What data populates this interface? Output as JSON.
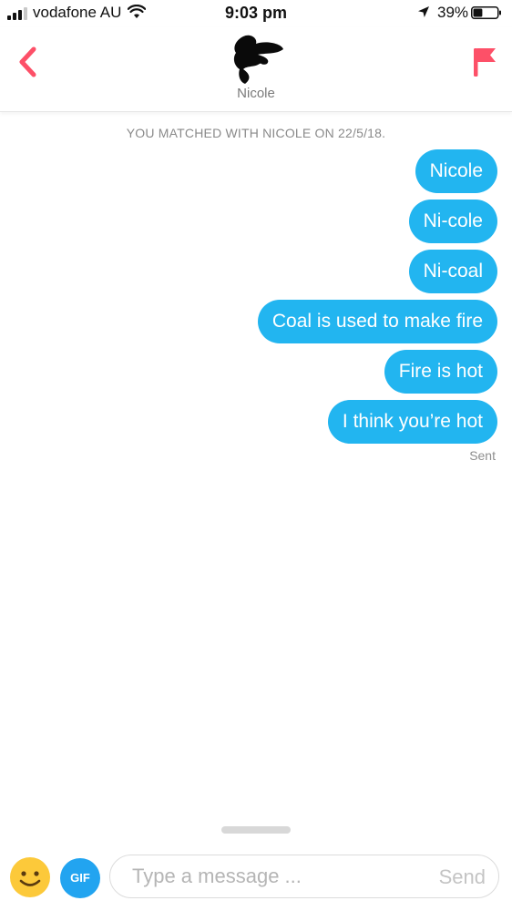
{
  "status_bar": {
    "carrier": "vodafone AU",
    "time": "9:03 pm",
    "battery_percent": "39%",
    "battery_level": 0.39,
    "icons": [
      "signal-icon",
      "wifi-icon",
      "location-arrow-icon",
      "battery-icon"
    ]
  },
  "header": {
    "match_name": "Nicole",
    "back_icon": "chevron-left-icon",
    "report_icon": "flag-icon",
    "accent_color": "#fd5068"
  },
  "conversation": {
    "match_notice": "YOU MATCHED WITH NICOLE ON 22/5/18.",
    "messages": [
      {
        "text": "Nicole",
        "sender": "me"
      },
      {
        "text": "Ni-cole",
        "sender": "me"
      },
      {
        "text": "Ni-coal",
        "sender": "me"
      },
      {
        "text": "Coal is used to make fire",
        "sender": "me"
      },
      {
        "text": "Fire is hot",
        "sender": "me"
      },
      {
        "text": "I think you’re hot",
        "sender": "me"
      }
    ],
    "status": "Sent",
    "bubble_color": "#22b5f0"
  },
  "composer": {
    "emoji_icon": "smiley-face-icon",
    "gif_label": "GIF",
    "placeholder": "Type a message ...",
    "value": "",
    "send_label": "Send"
  }
}
